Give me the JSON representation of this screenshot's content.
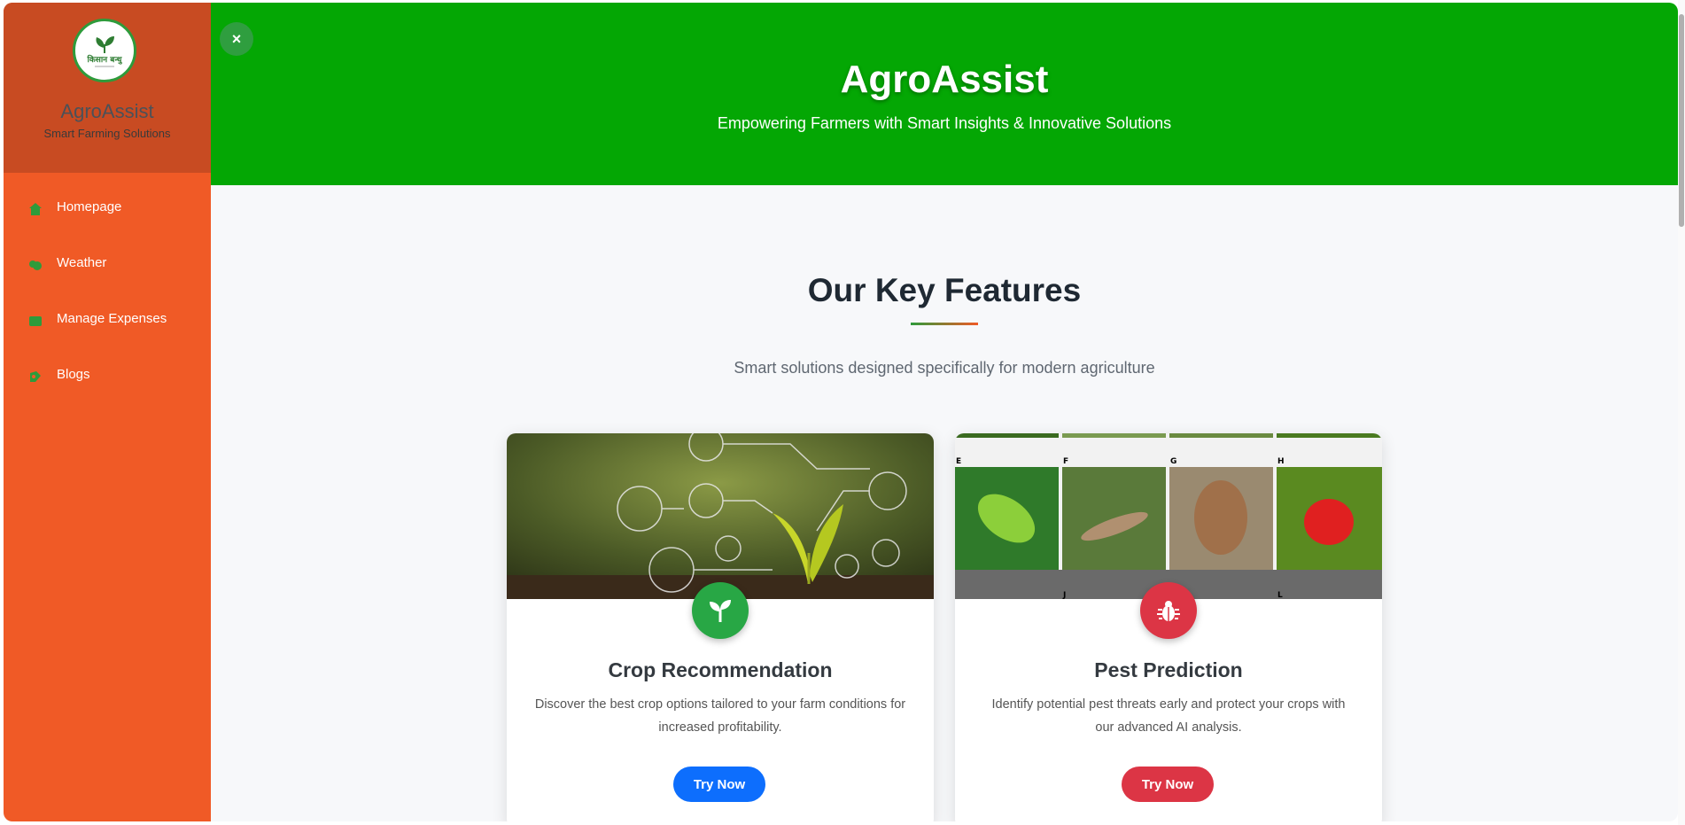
{
  "brand": {
    "name": "AgroAssist",
    "tagline": "Smart Farming Solutions",
    "logo_text": "किसान बन्धु"
  },
  "nav": [
    {
      "label": "Homepage",
      "icon": "home-icon"
    },
    {
      "label": "Weather",
      "icon": "cloud-icon"
    },
    {
      "label": "Manage Expenses",
      "icon": "wallet-icon"
    },
    {
      "label": "Blogs",
      "icon": "blog-icon"
    }
  ],
  "header": {
    "close_label": "×",
    "title": "AgroAssist",
    "subtitle": "Empowering Farmers with Smart Insights & Innovative Solutions"
  },
  "features": {
    "title": "Our Key Features",
    "subtitle": "Smart solutions designed specifically for modern agriculture",
    "cards": [
      {
        "title": "Crop Recommendation",
        "description": "Discover the best crop options tailored to your farm conditions for increased profitability.",
        "button": "Try Now",
        "icon": "seedling-icon",
        "accent": "#28a745"
      },
      {
        "title": "Pest Prediction",
        "description": "Identify potential pest threats early and protect your crops with our advanced AI analysis.",
        "button": "Try Now",
        "icon": "bug-icon",
        "accent": "#dc3545",
        "panel_labels": [
          "E",
          "F",
          "G",
          "H",
          "J",
          "L"
        ]
      }
    ]
  },
  "colors": {
    "sidebar": "#f05a26",
    "brand_block": "#c84b22",
    "header": "#04a704",
    "primary_button": "#0d6efd",
    "danger_button": "#dc3545"
  }
}
